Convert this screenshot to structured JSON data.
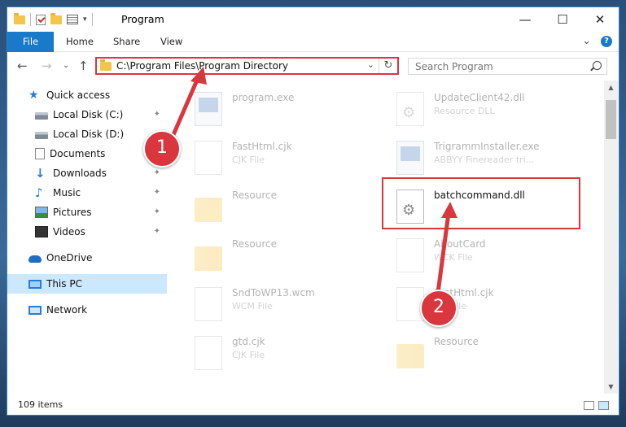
{
  "window": {
    "title": "Program",
    "controls": {
      "minimize": "—",
      "maximize": "☐",
      "close": "✕"
    }
  },
  "ribbon": {
    "tabs": [
      "File",
      "Home",
      "Share",
      "View"
    ],
    "expand": "⌄",
    "help": "?"
  },
  "nav": {
    "back": "←",
    "forward": "→",
    "recent": "⌄",
    "up": "↑",
    "address": "C:\\Program Files\\Program Directory",
    "dropdown": "⌄",
    "refresh": "↻",
    "search_placeholder": "Search Program"
  },
  "sidebar": {
    "items": [
      {
        "label": "Quick access",
        "icon": "star-icon"
      },
      {
        "label": "Local Disk (C:)",
        "icon": "disk-icon",
        "pinned": true
      },
      {
        "label": "Local Disk (D:)",
        "icon": "disk-icon"
      },
      {
        "label": "Documents",
        "icon": "documents-icon"
      },
      {
        "label": "Downloads",
        "icon": "download-icon",
        "pinned": true
      },
      {
        "label": "Music",
        "icon": "music-icon",
        "pinned": true
      },
      {
        "label": "Pictures",
        "icon": "pictures-icon",
        "pinned": true
      },
      {
        "label": "Videos",
        "icon": "videos-icon",
        "pinned": true
      },
      {
        "label": "OneDrive",
        "icon": "cloud-icon"
      },
      {
        "label": "This PC",
        "icon": "pc-icon",
        "selected": true
      },
      {
        "label": "Network",
        "icon": "network-icon"
      }
    ],
    "pin_glyph": "📌"
  },
  "files": [
    {
      "name": "program.exe",
      "type": ""
    },
    {
      "name": "UpdateClient42.dll",
      "type": "Resource DLL"
    },
    {
      "name": "FastHtml.cjk",
      "type": "CJK File"
    },
    {
      "name": "TrigrammInstaller.exe",
      "type": "ABBYY Finereader tri..."
    },
    {
      "name": "Resource",
      "type": ""
    },
    {
      "name": "batchcommand.dll",
      "type": ""
    },
    {
      "name": "Resource",
      "type": ""
    },
    {
      "name": "AboutCard",
      "type": "WCK File"
    },
    {
      "name": "SndToWP13.wcm",
      "type": "WCM File"
    },
    {
      "name": "FastHtml.cjk",
      "type": "CJK File"
    },
    {
      "name": "gtd.cjk",
      "type": "CJK File"
    },
    {
      "name": "Resource",
      "type": ""
    }
  ],
  "status": {
    "items_count": "109 items"
  },
  "scroll": {
    "up": "▲",
    "down": "▼"
  },
  "annotations": {
    "badge1": "1",
    "badge2": "2"
  },
  "colors": {
    "accent": "#1979ca",
    "annotation_red": "#d9363e",
    "selected_bg": "#cce8ff"
  }
}
